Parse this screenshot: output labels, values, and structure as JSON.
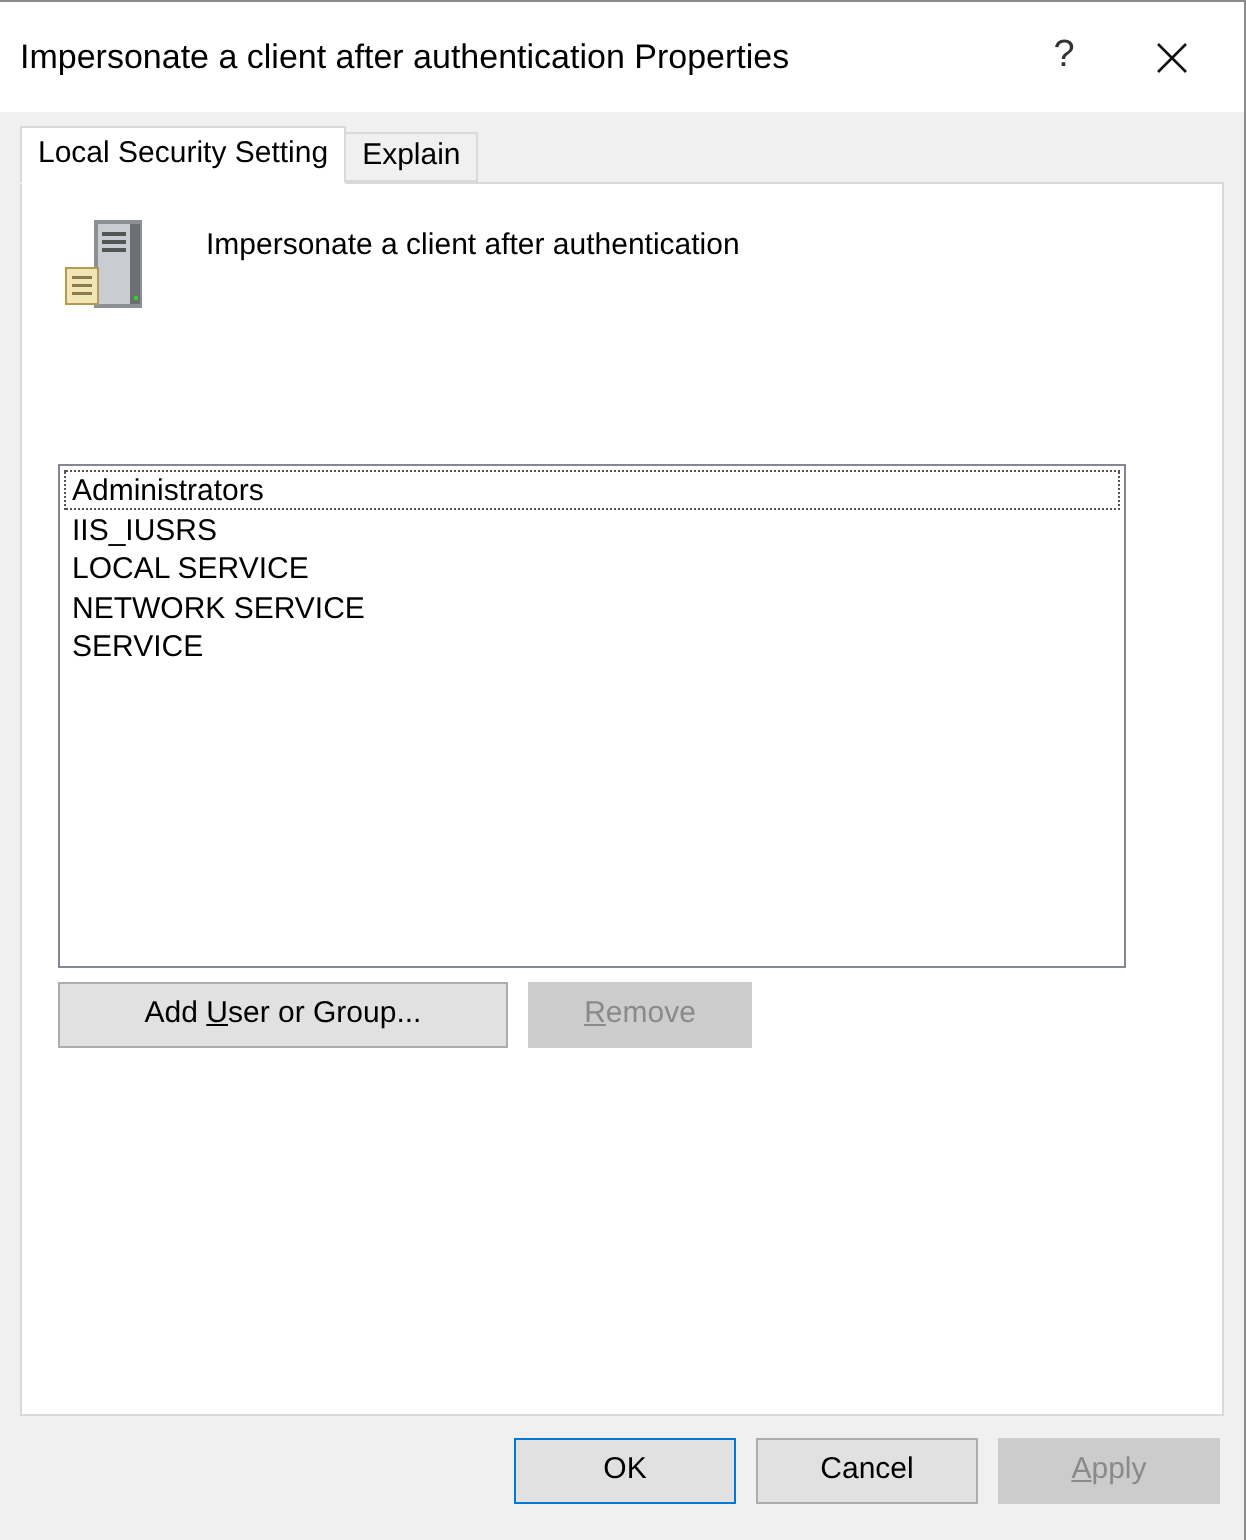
{
  "window": {
    "title": "Impersonate a client after authentication Properties",
    "help": "?"
  },
  "tabs": [
    {
      "label": "Local Security Setting",
      "selected": true
    },
    {
      "label": "Explain",
      "selected": false
    }
  ],
  "policy_name": "Impersonate a client after authentication",
  "members": [
    {
      "name": "Administrators",
      "selected": true
    },
    {
      "name": "IIS_IUSRS",
      "selected": false
    },
    {
      "name": "LOCAL SERVICE",
      "selected": false
    },
    {
      "name": "NETWORK SERVICE",
      "selected": false
    },
    {
      "name": "SERVICE",
      "selected": false
    }
  ],
  "list_buttons": [
    {
      "before": "Add ",
      "key": "U",
      "after": "ser or Group...",
      "disabled": false
    },
    {
      "key": "R",
      "after": "emove",
      "disabled": true
    }
  ],
  "dialog_buttons": [
    {
      "before": "OK",
      "disabled": false,
      "default": true
    },
    {
      "before": "Cancel",
      "disabled": false,
      "default": false
    },
    {
      "key": "A",
      "after": "pply",
      "disabled": true,
      "default": false
    }
  ]
}
